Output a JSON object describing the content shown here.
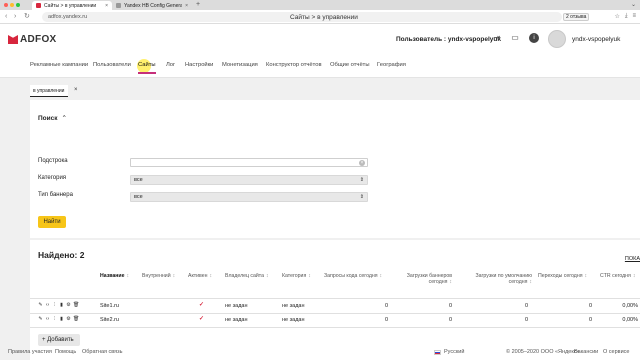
{
  "browser": {
    "tabs": [
      {
        "title": "Сайты > в управлении",
        "active": true
      },
      {
        "title": "Yandex HB Config Generat",
        "active": false
      }
    ],
    "new_tab": "+",
    "url": "adfox.yandex.ru",
    "page_title": "Сайты > в управлении",
    "badge": "2 отзыва"
  },
  "header": {
    "logo_text": "ADFOX",
    "user_label": "Пользователь : yndx-vspopelyuk",
    "avatar_name": "yndx-vspopelyuk"
  },
  "menu": {
    "items": [
      "Рекламные кампании",
      "Пользователи",
      "Сайты",
      "Лог",
      "Настройки",
      "Монетизация",
      "Конструктор отчётов",
      "Общие отчёты",
      "География"
    ],
    "active_index": 2
  },
  "subtab": {
    "label": "в управлении",
    "close": "×"
  },
  "search": {
    "title": "Поиск",
    "substring_label": "Подстрока",
    "category_label": "Категория",
    "category_value": "все",
    "banner_type_label": "Тип баннера",
    "banner_type_value": "все",
    "find_button": "Найти"
  },
  "results": {
    "found": "Найдено: 2",
    "show_link": "ПОКА",
    "columns": [
      "Название",
      "Внутренний",
      "Активен",
      "Владелец сайта",
      "Категория",
      "Запросы кода сегодня",
      "Загрузки баннеров сегодня",
      "Загрузки по умолчанию сегодня",
      "Переходы сегодня",
      "CTR сегодня"
    ],
    "rows": [
      {
        "name": "Site1.ru",
        "owner": "не задан",
        "category": "не задан",
        "requests": "0",
        "banner_loads": "0",
        "default_loads": "0",
        "clicks": "0",
        "ctr": "0,00%"
      },
      {
        "name": "Site2.ru",
        "owner": "не задан",
        "category": "не задан",
        "requests": "0",
        "banner_loads": "0",
        "default_loads": "0",
        "clicks": "0",
        "ctr": "0,00%"
      }
    ],
    "add_button": "+ Добавить"
  },
  "footer": {
    "links": [
      "Правила участия",
      "Помощь",
      "Обратная связь"
    ],
    "language": "Русский",
    "copyright": "© 2005–2020 ООО «Яндекс»",
    "vacancies": "Вакансии",
    "about": "О сервисе"
  },
  "colors": {
    "brand": "#d7263d",
    "accent_underline": "#c62f7a",
    "button_yellow": "#f7c518"
  }
}
